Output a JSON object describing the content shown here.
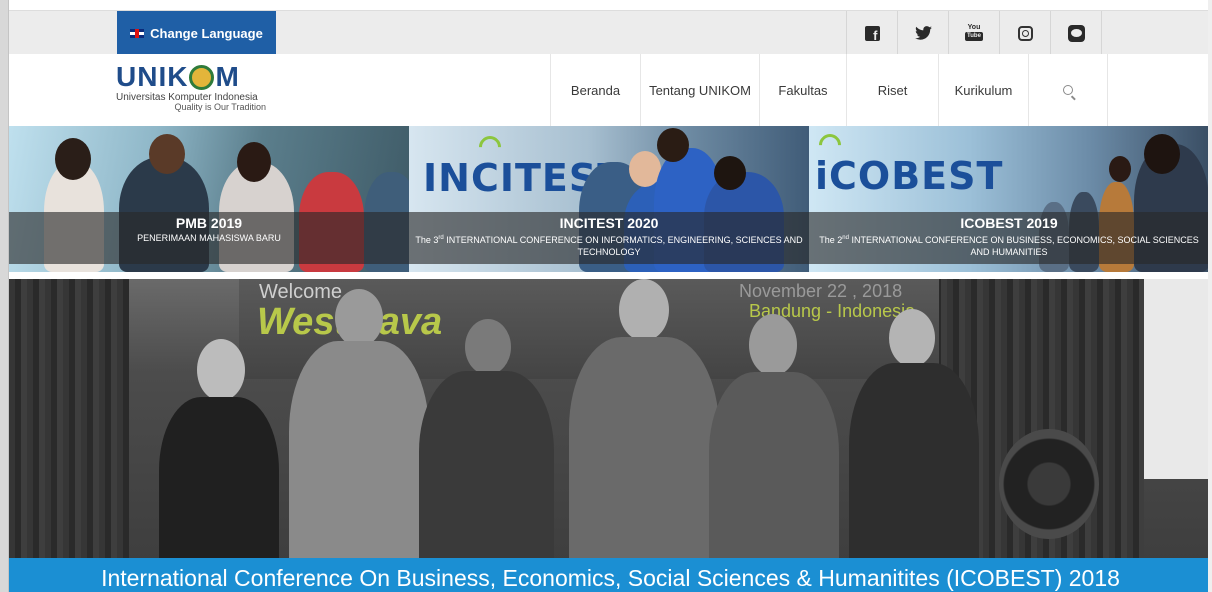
{
  "topbar": {
    "language_button": "Change Language",
    "social_icons": [
      "facebook-icon",
      "twitter-icon",
      "youtube-icon",
      "instagram-icon",
      "line-icon"
    ],
    "youtube_text_top": "You",
    "youtube_text_bottom": "Tube"
  },
  "logo": {
    "word_left": "UNIK",
    "word_right": "M",
    "subtitle": "Universitas Komputer Indonesia",
    "tagline": "Quality is Our Tradition"
  },
  "nav": {
    "items": [
      "Beranda",
      "Tentang UNIKOM",
      "Fakultas",
      "Riset",
      "Kurikulum"
    ]
  },
  "banners": [
    {
      "title": "PMB 2019",
      "subtitle": "PENERIMAAN MAHASISWA BARU"
    },
    {
      "logo_text": "INCITEST",
      "title": "INCITEST 2020",
      "subtitle_pre": "The 3",
      "subtitle_sup": "rd",
      "subtitle_post": " INTERNATIONAL CONFERENCE ON INFORMATICS, ENGINEERING, SCIENCES AND TECHNOLOGY"
    },
    {
      "logo_text": "iCOBEST",
      "title": "ICOBEST 2019",
      "subtitle_pre": "The 2",
      "subtitle_sup": "nd",
      "subtitle_post": " INTERNATIONAL CONFERENCE ON BUSINESS, ECONOMICS, SOCIAL SCIENCES AND HUMANITIES"
    }
  ],
  "hero": {
    "backdrop_text_1": "Welcome",
    "backdrop_text_2": "West Java",
    "backdrop_text_3": "November 22 , 2018",
    "backdrop_text_4": "Bandung - Indonesia",
    "caption": "International Conference On Business, Economics, Social Sciences & Humanitites (ICOBEST) 2018"
  },
  "colors": {
    "accent_blue": "#1f5fa6",
    "caption_blue": "#1b8fd3",
    "logo_blue": "#1f4c8a",
    "green": "#8cc63e"
  }
}
